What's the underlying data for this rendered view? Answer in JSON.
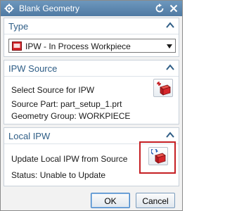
{
  "window": {
    "title": "Blank Geometry"
  },
  "type_section": {
    "header": "Type",
    "selected": "IPW - In Process Workpiece",
    "icon": "ipw-block-icon"
  },
  "ipw_source": {
    "header": "IPW Source",
    "select_label": "Select Source for IPW",
    "source_part": "Source Part: part_setup_1.prt",
    "geometry_group": "Geometry Group: WORKPIECE"
  },
  "local_ipw": {
    "header": "Local IPW",
    "update_label": "Update Local IPW from Source",
    "status": "Status: Unable to Update"
  },
  "footer": {
    "ok_label": "OK",
    "cancel_label": "Cancel"
  },
  "colors": {
    "titlebar": "#4f7aa3",
    "section_header": "#2e5d86",
    "highlight": "#c51f24"
  }
}
